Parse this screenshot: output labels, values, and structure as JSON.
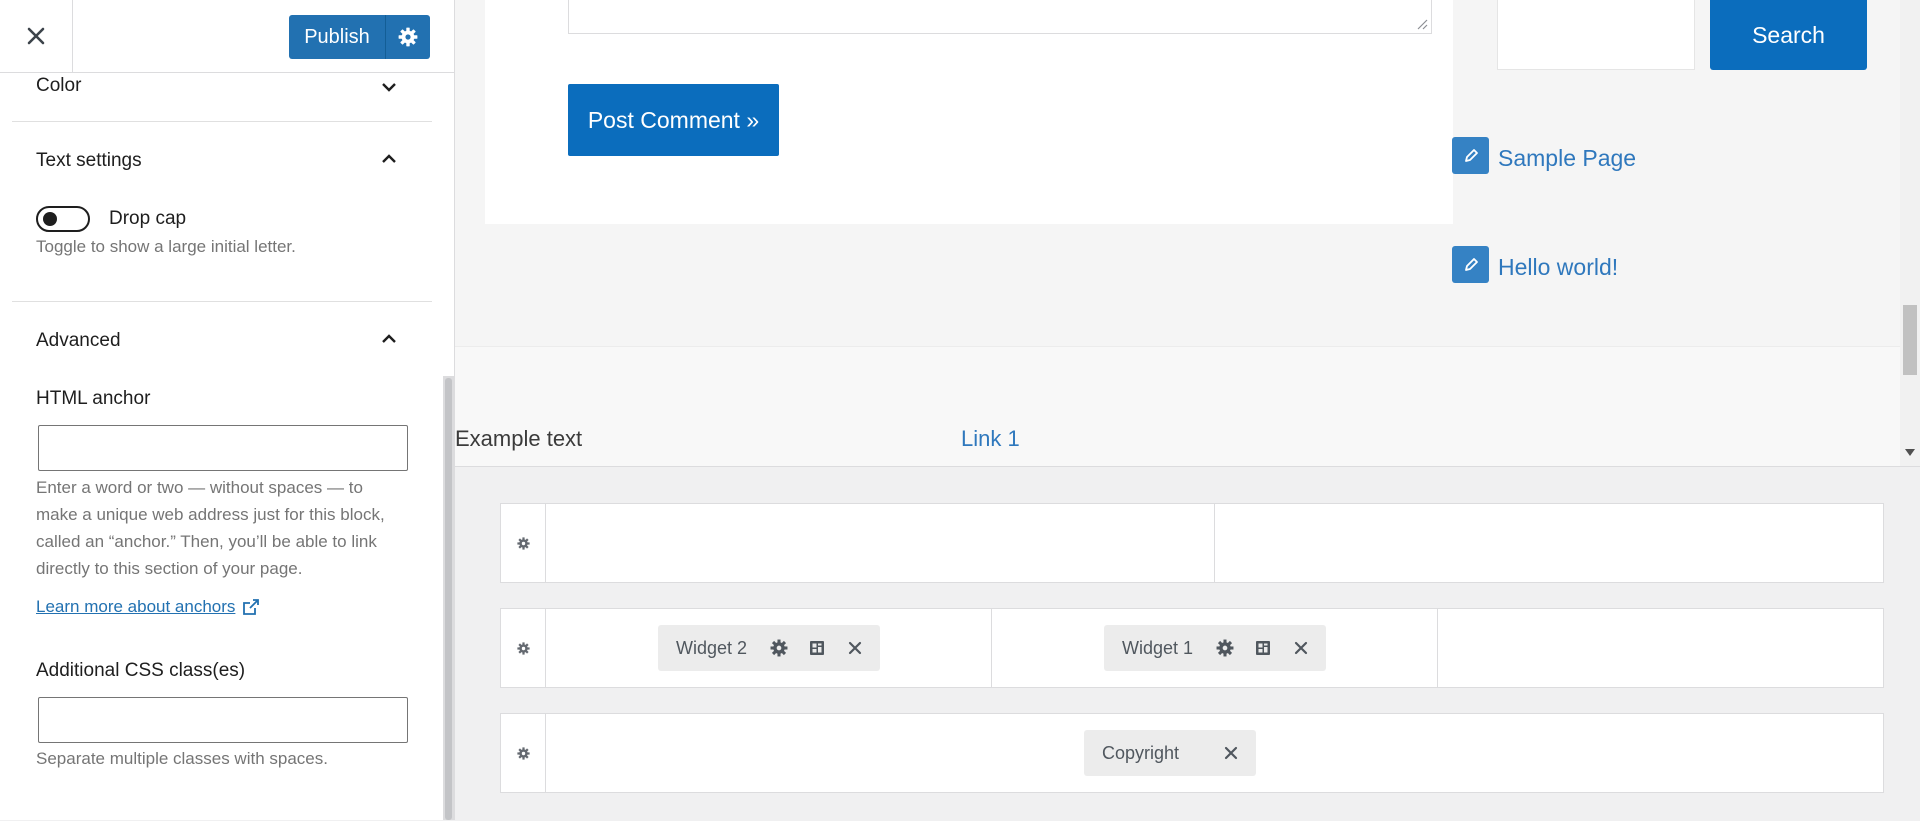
{
  "header": {
    "publish_label": "Publish"
  },
  "panels": {
    "color": {
      "title": "Color"
    },
    "text_settings": {
      "title": "Text settings",
      "drop_cap_label": "Drop cap",
      "drop_cap_help": "Toggle to show a large initial letter.",
      "drop_cap_enabled": false
    },
    "advanced": {
      "title": "Advanced",
      "html_anchor_label": "HTML anchor",
      "html_anchor_value": "",
      "html_anchor_help": [
        "Enter a word or two — without spaces — to",
        "make a unique web address just for this block,",
        "called an “anchor.” Then, you’ll be able to link",
        "directly to this section of your page."
      ],
      "learn_more_link": "Learn more about anchors",
      "css_classes_label": "Additional CSS class(es)",
      "css_classes_value": "",
      "css_classes_help": "Separate multiple classes with spaces."
    }
  },
  "preview": {
    "post_comment_label": "Post Comment »",
    "search_label": "Search",
    "sidebar_links": [
      "Sample Page",
      "Hello world!"
    ],
    "footer_text": "Example text",
    "footer_link": "Link 1"
  },
  "builder": {
    "widgets": {
      "widget2": "Widget 2",
      "widget1": "Widget 1",
      "copyright": "Copyright"
    }
  },
  "colors": {
    "primary": "#2271b1",
    "button_blue": "#0b6dbd",
    "link_blue": "#2f78bd",
    "edit_icon_bg": "#3582c4"
  },
  "icons": [
    "close-icon",
    "gear-icon",
    "chevron-down-icon",
    "chevron-up-icon",
    "external-link-icon",
    "pencil-icon",
    "layout-icon"
  ]
}
